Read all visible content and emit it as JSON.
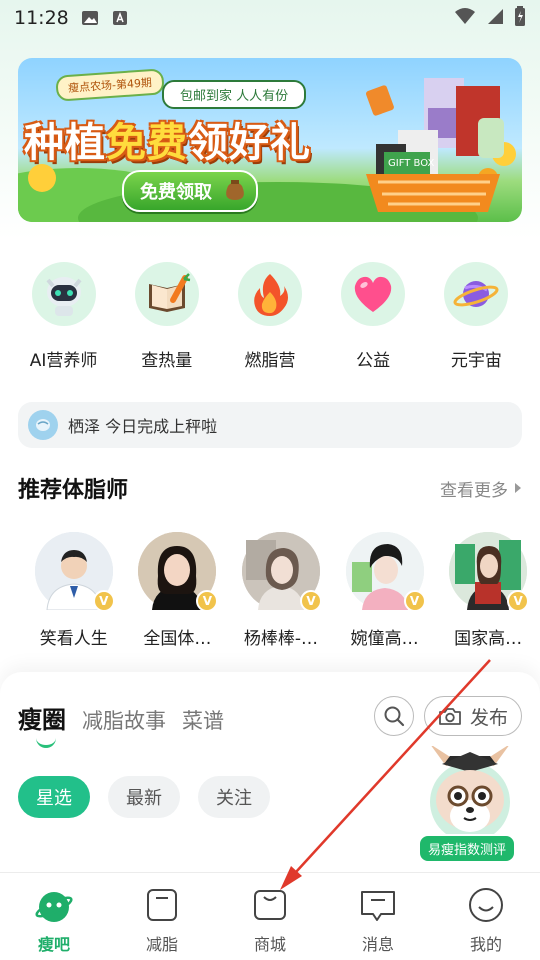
{
  "status_bar": {
    "time": "11:28"
  },
  "banner": {
    "tag": "瘦点农场-第49期",
    "subtitle": "包邮到家 人人有份",
    "title_part1": "种植",
    "title_part2": "免费",
    "title_part3": "领好礼",
    "button": "免费领取",
    "gift_box_text": "GIFT BOX",
    "slide_index": 3,
    "slide_count": 4
  },
  "quick_entries": [
    {
      "label": "AI营养师",
      "icon": "robot-icon"
    },
    {
      "label": "查热量",
      "icon": "book-carrot-icon"
    },
    {
      "label": "燃脂营",
      "icon": "flame-icon"
    },
    {
      "label": "公益",
      "icon": "heart-icon"
    },
    {
      "label": "元宇宙",
      "icon": "planet-icon"
    }
  ],
  "notice": {
    "text": "栖泽 今日完成上秤啦"
  },
  "coaches_section": {
    "title": "推荐体脂师",
    "more": "查看更多",
    "coaches": [
      {
        "name": "笑看人生",
        "badge": "V"
      },
      {
        "name": "全国体…",
        "badge": "V"
      },
      {
        "name": "杨棒棒-…",
        "badge": "V"
      },
      {
        "name": "婉僮高…",
        "badge": "V"
      },
      {
        "name": "国家高…",
        "badge": "V"
      }
    ]
  },
  "feed": {
    "tabs": [
      "瘦圈",
      "减脂故事",
      "菜谱"
    ],
    "publish": "发布",
    "chips": [
      "星选",
      "最新",
      "关注"
    ]
  },
  "mascot": {
    "label": "易瘦指数测评"
  },
  "bottom_nav": [
    {
      "label": "瘦吧",
      "active": true
    },
    {
      "label": "减脂",
      "active": false
    },
    {
      "label": "商城",
      "active": false
    },
    {
      "label": "消息",
      "active": false
    },
    {
      "label": "我的",
      "active": false
    }
  ],
  "colors": {
    "accent": "#22c08a",
    "annotation_arrow": "#e0392b"
  }
}
